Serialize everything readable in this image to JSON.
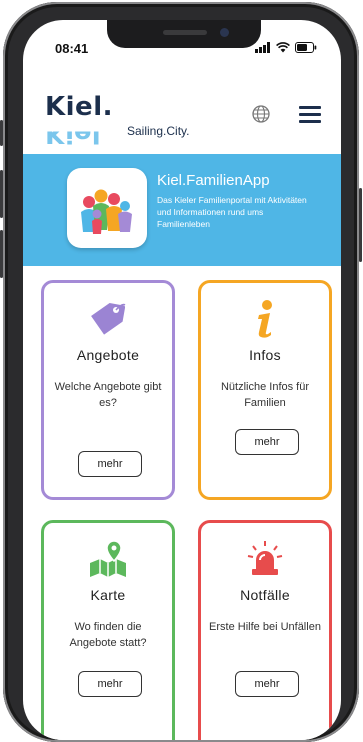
{
  "status_bar": {
    "time": "08:41"
  },
  "header": {
    "logo_text": "Kiel.",
    "logo_mirror_text": "Kiel",
    "tagline": "Sailing.City."
  },
  "banner": {
    "title": "Kiel.FamilienApp",
    "subtitle": "Das Kieler Familienportal mit Aktivitäten und Informationen rund ums Familienleben",
    "background_color": "#4fb6e6"
  },
  "cards": [
    {
      "title": "Angebote",
      "description": "Welche Angebote gibt es?",
      "button": "mehr",
      "border_color": "#a48ad6",
      "icon": "tag-icon"
    },
    {
      "title": "Infos",
      "description": "Nützliche Infos für Familien",
      "button": "mehr",
      "border_color": "#f5a623",
      "icon": "info-icon"
    },
    {
      "title": "Karte",
      "description": "Wo finden die Angebote statt?",
      "button": "mehr",
      "border_color": "#5cb85c",
      "icon": "map-icon"
    },
    {
      "title": "Notfälle",
      "description": "Erste Hilfe bei Unfällen",
      "button": "mehr",
      "border_color": "#e74c4c",
      "icon": "siren-icon"
    }
  ]
}
